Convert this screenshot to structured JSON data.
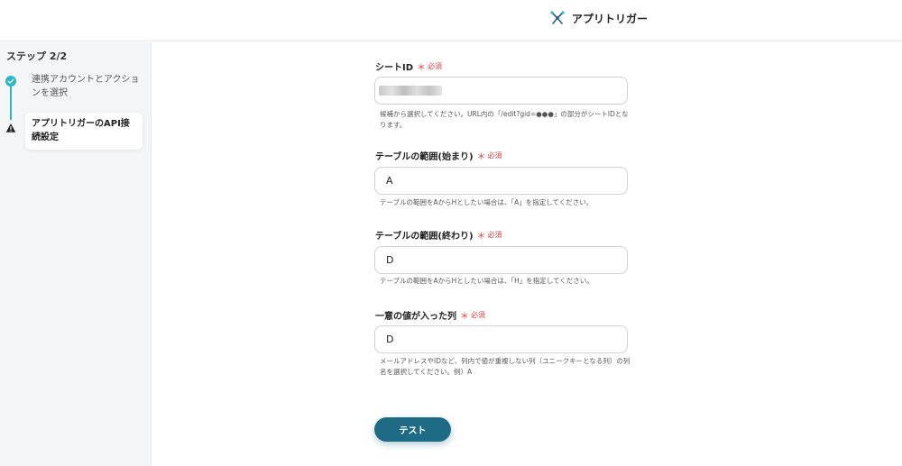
{
  "app": {
    "title": "アプリトリガー"
  },
  "sidebar": {
    "step_counter": "ステップ 2/2",
    "steps": [
      {
        "label": "連携アカウントとアクションを選択",
        "status": "complete"
      },
      {
        "label": "アプリトリガーのAPI接続設定",
        "status": "warning"
      }
    ]
  },
  "form": {
    "required_label": "必須",
    "fields": [
      {
        "label": "シートID",
        "value": "",
        "help": "候補から選択してください。URL内の「/edit?gid=●●●」の部分がシートIDとなります。"
      },
      {
        "label": "テーブルの範囲(始まり)",
        "value": "A",
        "help": "テーブルの範囲をAからHとしたい場合は、「A」を指定してください。"
      },
      {
        "label": "テーブルの範囲(終わり)",
        "value": "D",
        "help": "テーブルの範囲をAからHとしたい場合は、「H」を指定してください。"
      },
      {
        "label": "一意の値が入った列",
        "value": "D",
        "help": "メールアドレスやIDなど、列内で値が重複しない列（ユニークキーとなる列）の列名を選択してください。例）A"
      }
    ],
    "test_button": "テスト"
  },
  "colors": {
    "accent": "#2bb8c6",
    "button": "#1f6a84",
    "required": "#e03c3c"
  }
}
